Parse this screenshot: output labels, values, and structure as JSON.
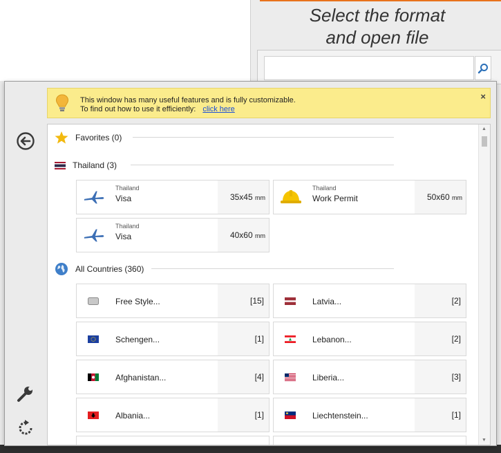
{
  "app": {
    "title_line1": "Select the format",
    "title_line2": "and open file",
    "search": {
      "value": "",
      "placeholder": ""
    }
  },
  "banner": {
    "line1": "This window has many useful features and is fully customizable.",
    "line2": "To find out how to use it efficiently:",
    "link": "click here",
    "close": "×"
  },
  "sections": {
    "favorites": {
      "label": "Favorites (0)"
    },
    "thailand": {
      "label": "Thailand (3)"
    },
    "all": {
      "label": "All Countries (360)"
    }
  },
  "thailand_items": [
    {
      "country": "Thailand",
      "name": "Visa",
      "size": "35x45",
      "unit": "mm",
      "icon": "airplane-icon"
    },
    {
      "country": "Thailand",
      "name": "Work Permit",
      "size": "50x60",
      "unit": "mm",
      "icon": "hardhat-icon"
    },
    {
      "country": "Thailand",
      "name": "Visa",
      "size": "40x60",
      "unit": "mm",
      "icon": "airplane-icon"
    }
  ],
  "countries": [
    {
      "name": "Free Style...",
      "count": "[15]"
    },
    {
      "name": "Latvia...",
      "count": "[2]"
    },
    {
      "name": "Schengen...",
      "count": "[1]"
    },
    {
      "name": "Lebanon...",
      "count": "[2]"
    },
    {
      "name": "Afghanistan...",
      "count": "[4]"
    },
    {
      "name": "Liberia...",
      "count": "[3]"
    },
    {
      "name": "Albania...",
      "count": "[1]"
    },
    {
      "name": "Liechtenstein...",
      "count": "[1]"
    }
  ],
  "colors": {
    "accent": "#e8721c",
    "banner": "#fbec8c",
    "icon_blue": "#3c6fb5"
  }
}
